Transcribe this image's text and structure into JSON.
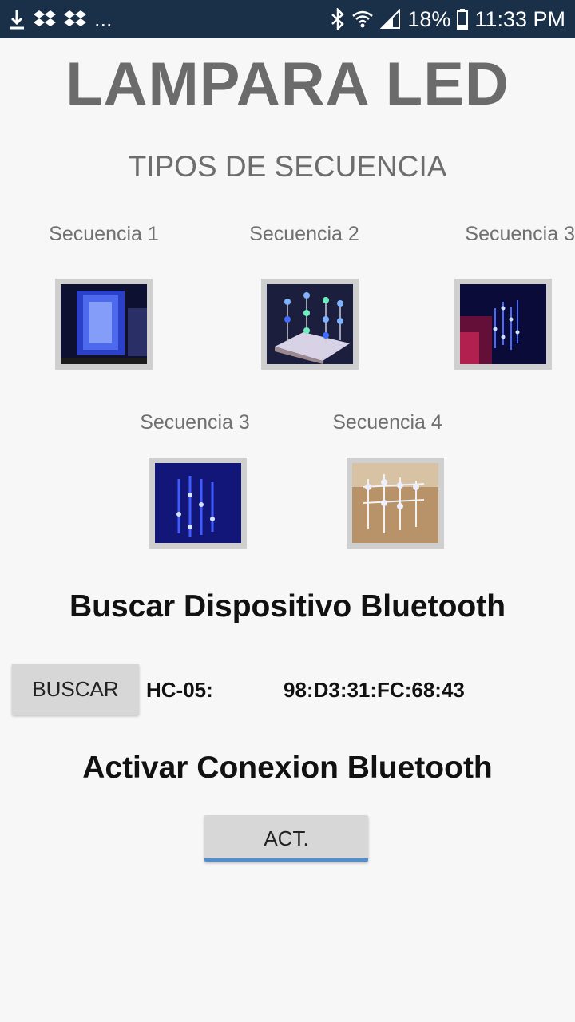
{
  "status_bar": {
    "battery": "18%",
    "time": "11:33 PM",
    "more": "...",
    "left_icons": [
      "download-icon",
      "dropbox-icon",
      "dropbox-icon"
    ],
    "right_icons": [
      "bluetooth-icon",
      "wifi-icon",
      "signal-icon",
      "battery-icon"
    ]
  },
  "app": {
    "title": "LAMPARA LED",
    "section_title": "TIPOS DE SECUENCIA"
  },
  "sequences": [
    {
      "label": "Secuencia 1"
    },
    {
      "label": "Secuencia 2"
    },
    {
      "label": "Secuencia 3"
    },
    {
      "label": "Secuencia 3"
    },
    {
      "label": "Secuencia 4"
    }
  ],
  "bluetooth": {
    "search_title": "Buscar Dispositivo Bluetooth",
    "search_button": "BUSCAR",
    "device_name": "HC-05:",
    "device_address": "98:D3:31:FC:68:43",
    "activate_title": "Activar Conexion Bluetooth",
    "activate_button": "ACT."
  },
  "colors": {
    "status_bar_bg": "#1a2f48",
    "title_gray": "#6b6b6b",
    "button_bg": "#d7d7d7",
    "accent_underline": "#4a90d9"
  }
}
